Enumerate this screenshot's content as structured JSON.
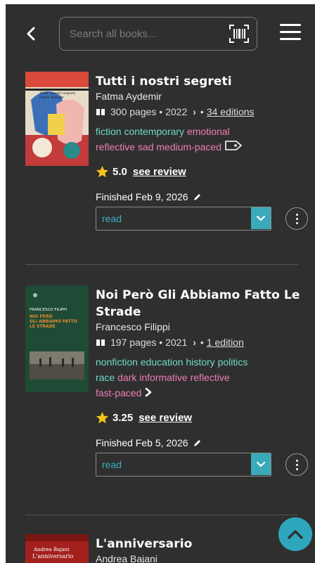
{
  "header": {
    "search_placeholder": "Search all books..."
  },
  "books": [
    {
      "title": "Tutti i nostri segreti",
      "author": "Fatma Aydemir",
      "pages": "300 pages",
      "year": "2022",
      "editions": "34 editions",
      "tags_green": [
        "fiction",
        "contemporary"
      ],
      "tags_pink": [
        "emotional",
        "reflective",
        "sad",
        "medium-paced"
      ],
      "rating": "5.0",
      "see_review": "see review",
      "finished": "Finished Feb 9, 2026",
      "status": "read",
      "cover_text": "Fatma Aydemir"
    },
    {
      "title": "Noi Però Gli Abbiamo Fatto Le Strade",
      "author": "Francesco Filippi",
      "pages": "197 pages",
      "year": "2021",
      "editions": "1 edition",
      "tags_green": [
        "nonfiction",
        "education",
        "history",
        "politics",
        "race"
      ],
      "tags_pink": [
        "dark",
        "informative",
        "reflective",
        "fast-paced"
      ],
      "rating": "3.25",
      "see_review": "see review",
      "finished": "Finished Feb 5, 2026",
      "status": "read",
      "cover_author": "FRANCESCO FILIPPI",
      "cover_title": "NOI PERÒ GLI ABBIAMO FATTO LE STRADE"
    },
    {
      "title": "L'anniversario",
      "author": "Andrea Bajani",
      "cover_author": "Andrea Bajani",
      "cover_title": "L'anniversario"
    }
  ],
  "colors": {
    "background": "#2f2f2f",
    "tag_green": "#6fd9c6",
    "tag_pink": "#ee7fb4",
    "accent": "#3aaabb",
    "star": "#f5c518"
  }
}
